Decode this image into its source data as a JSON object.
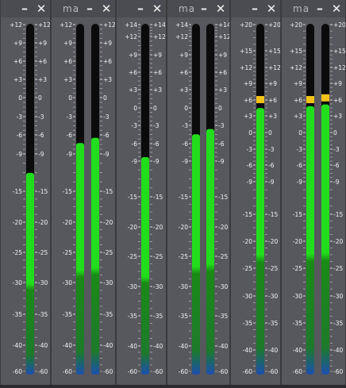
{
  "windows": [
    {
      "title": "",
      "min": "–",
      "close": "✕",
      "scale": "s12",
      "bars": [
        0.575
      ],
      "peaks": [
        null
      ]
    },
    {
      "title": "ma",
      "min": "–",
      "close": "✕",
      "scale": "s12",
      "bars": [
        0.66,
        0.675
      ],
      "peaks": [
        null,
        null
      ]
    },
    {
      "title": "",
      "min": "–",
      "close": "✕",
      "scale": "s14",
      "bars": [
        0.62
      ],
      "peaks": [
        null
      ]
    },
    {
      "title": "ma",
      "min": "–",
      "close": "✕",
      "scale": "s14",
      "bars": [
        0.685,
        0.7
      ],
      "peaks": [
        null,
        null
      ]
    },
    {
      "title": "",
      "min": "–",
      "close": "✕",
      "scale": "s20",
      "bars": [
        0.76
      ],
      "peaks": [
        0.785
      ]
    },
    {
      "title": "ma",
      "min": "–",
      "close": "✕",
      "scale": "s20",
      "bars": [
        0.765,
        0.77
      ],
      "peaks": [
        0.785,
        0.79
      ]
    }
  ],
  "scales": {
    "s12": [
      "+12",
      "+9",
      "+6",
      "+3",
      "0",
      "-3",
      "-6",
      "-9",
      "-15",
      "-20",
      "-25",
      "-30",
      "-35",
      "-40",
      "-60"
    ],
    "s14": [
      "+14",
      "+12",
      "+9",
      "+6",
      "+3",
      "0",
      "-3",
      "-6",
      "-9",
      "-15",
      "-20",
      "-25",
      "-30",
      "-35",
      "-40",
      "-60"
    ],
    "s20": [
      "+20",
      "+15",
      "+12",
      "+9",
      "+6",
      "+3",
      "0",
      "-3",
      "-6",
      "-9",
      "-15",
      "-20",
      "-25",
      "-30",
      "-35",
      "-40",
      "-60"
    ]
  },
  "colors": {
    "green": "#22dd1c",
    "green_dark": "#1a8a16",
    "blue": "#1d4fb0",
    "peak": "#f2c21a",
    "track": "#0b0b0c"
  }
}
